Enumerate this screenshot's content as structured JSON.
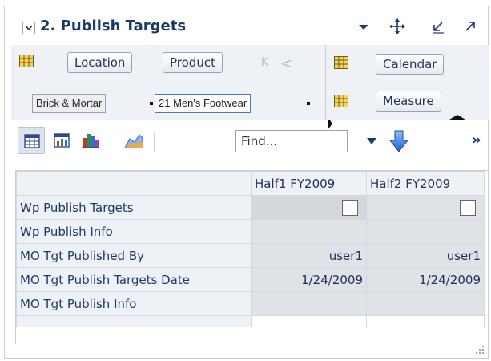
{
  "panel": {
    "title": "2. Publish Targets"
  },
  "pivot": {
    "row_tiles": [
      "Location",
      "Product"
    ],
    "column_tiles": [
      "Calendar",
      "Measure"
    ],
    "selections": [
      "Brick & Mortar",
      "21 Men's Footwear"
    ]
  },
  "toolbar": {
    "find_placeholder": "Find..."
  },
  "grid": {
    "columns": [
      "Half1 FY2009",
      "Half2 FY2009"
    ],
    "rows": [
      {
        "label": "Wp Publish Targets",
        "values": [
          "",
          ""
        ],
        "type": "checkbox"
      },
      {
        "label": "Wp Publish Info",
        "values": [
          "",
          ""
        ]
      },
      {
        "label": "MO Tgt Published By",
        "values": [
          "user1",
          "user1"
        ]
      },
      {
        "label": "MO Tgt Publish Targets Date",
        "values": [
          "1/24/2009",
          "1/24/2009"
        ]
      },
      {
        "label": "MO Tgt Publish Info",
        "values": [
          "",
          ""
        ]
      }
    ]
  },
  "colors": {
    "title": "#1a3a6a",
    "accent": "#2e6fd6",
    "cell_gray": "#d4d7dc"
  }
}
